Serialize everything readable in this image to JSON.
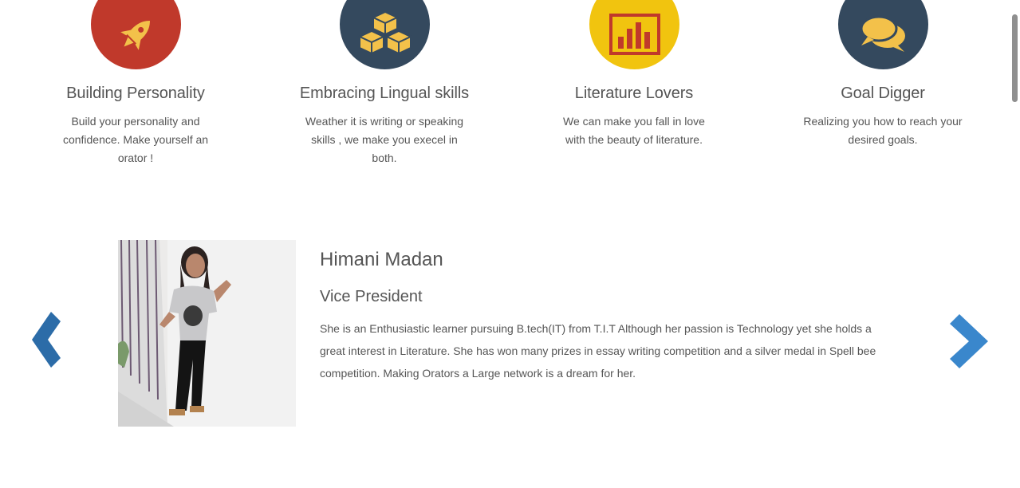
{
  "features": [
    {
      "title": "Building Personality",
      "description": "Build your personality and confidence. Make yourself an orator !",
      "icon": "rocket-icon",
      "color": "#c0392b"
    },
    {
      "title": "Embracing Lingual skills",
      "description": "Weather it is writing or speaking skills , we make you execel in both.",
      "icon": "cubes-icon",
      "color": "#34495e"
    },
    {
      "title": "Literature Lovers",
      "description": "We can make you fall in love with the beauty of literature.",
      "icon": "bar-chart-icon",
      "color": "#f1c40f"
    },
    {
      "title": "Goal Digger",
      "description": "Realizing you how to reach your desired goals.",
      "icon": "comments-icon",
      "color": "#34495e"
    }
  ],
  "team": {
    "name": "Himani Madan",
    "role": "Vice President",
    "bio": "She is an Enthusiastic learner pursuing B.tech(IT) from T.I.T Although her passion is Technology yet she holds a great interest in Literature. She has won many prizes in essay writing competition and a silver medal in Spell bee competition. Making Orators a Large network is a dream for her.",
    "photo_icon": "member-photo"
  },
  "carousel": {
    "prev_icon": "chevron-left-icon",
    "next_icon": "chevron-right-icon",
    "prev_color": "#2c6ca8",
    "next_color": "#3a87cc"
  }
}
